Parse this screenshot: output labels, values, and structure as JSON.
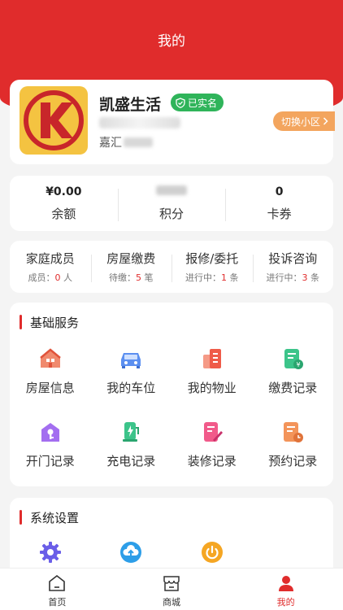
{
  "header": {
    "title": "我的"
  },
  "profile": {
    "name": "凯盛生活",
    "verified_label": "已实名",
    "community_prefix": "嘉汇",
    "switch_label": "切换小区"
  },
  "stats": [
    {
      "value": "¥0.00",
      "label": "余额"
    },
    {
      "value": "",
      "label": "积分"
    },
    {
      "value": "0",
      "label": "卡券"
    }
  ],
  "quick": [
    {
      "title": "家庭成员",
      "prefix": "成员：",
      "count": "0",
      "suffix": "人"
    },
    {
      "title": "房屋缴费",
      "prefix": "待缴：",
      "count": "5",
      "suffix": "笔"
    },
    {
      "title": "报修/委托",
      "prefix": "进行中：",
      "count": "1",
      "suffix": "条"
    },
    {
      "title": "投诉咨询",
      "prefix": "进行中：",
      "count": "3",
      "suffix": "条"
    }
  ],
  "services": {
    "title": "基础服务",
    "items": [
      {
        "label": "房屋信息",
        "icon": "house-icon"
      },
      {
        "label": "我的车位",
        "icon": "car-icon"
      },
      {
        "label": "我的物业",
        "icon": "building-icon"
      },
      {
        "label": "缴费记录",
        "icon": "bill-icon"
      },
      {
        "label": "开门记录",
        "icon": "door-key-icon"
      },
      {
        "label": "充电记录",
        "icon": "charging-icon"
      },
      {
        "label": "装修记录",
        "icon": "renovation-icon"
      },
      {
        "label": "预约记录",
        "icon": "appointment-icon"
      }
    ]
  },
  "settings": {
    "title": "系统设置",
    "icons": [
      "gear-icon",
      "cloud-upload-icon",
      "power-icon"
    ]
  },
  "tabbar": [
    {
      "label": "首页",
      "icon": "home-icon"
    },
    {
      "label": "商城",
      "icon": "shop-icon"
    },
    {
      "label": "我的",
      "icon": "user-icon",
      "active": true
    }
  ],
  "colors": {
    "primary": "#e02c2c",
    "verified": "#2fb45a",
    "switch": "#f3a55e",
    "logo_bg": "#f4c341"
  }
}
